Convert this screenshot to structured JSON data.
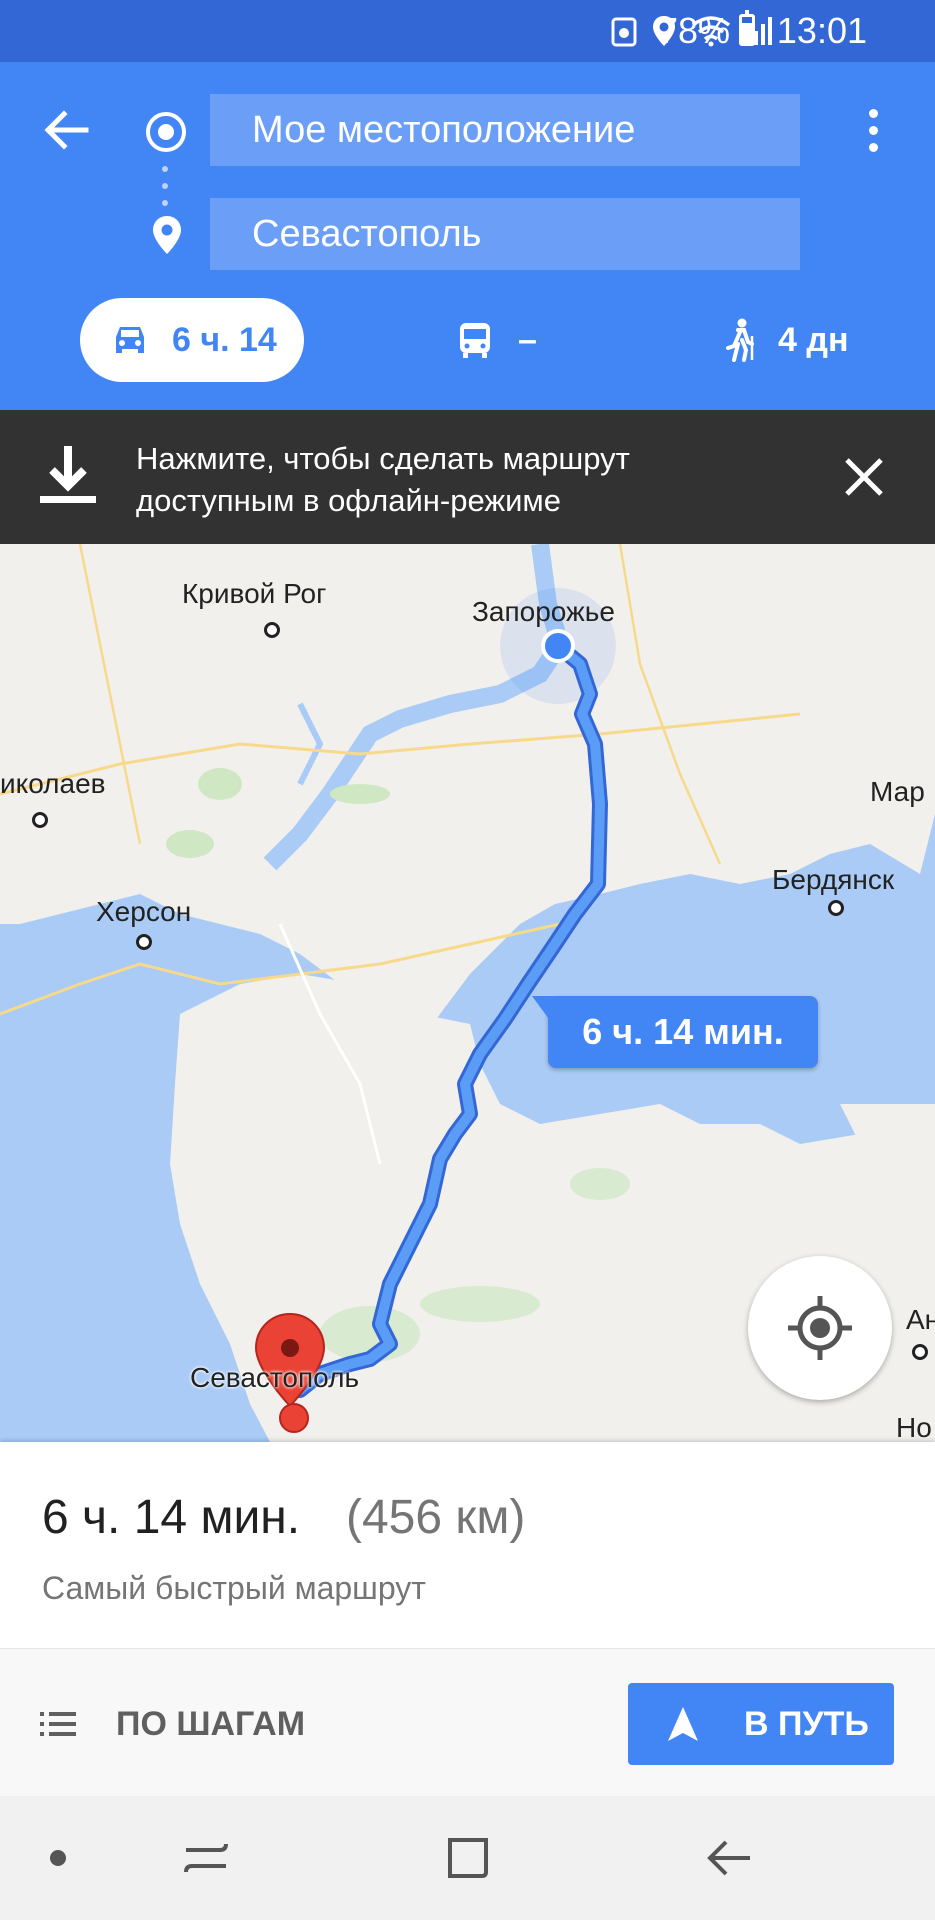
{
  "status_bar": {
    "battery": "78%",
    "time": "13:01",
    "icons": [
      "recycle-icon",
      "location-icon",
      "wifi-icon",
      "signal-icon",
      "battery-icon"
    ]
  },
  "header": {
    "origin": "Мое местоположение",
    "destination": "Севастополь"
  },
  "modes": {
    "car": "6 ч. 14",
    "transit": "–",
    "walk": "4 дн"
  },
  "offline_banner": {
    "line1": "Нажмите, чтобы сделать маршрут",
    "line2": "доступным в офлайн-режиме"
  },
  "map": {
    "labels": {
      "krivoy_rog": "Кривой Рог",
      "zaporozhye": "Запорожье",
      "nikolaev": "иколаев",
      "kherson": "Херсон",
      "berdyansk": "Бердянск",
      "mar": "Мар",
      "sevastopol": "Севастополь",
      "ana": "Ана",
      "no": "Но"
    },
    "eta_bubble": "6 ч. 14 мин."
  },
  "info": {
    "time": "6 ч. 14 мин.",
    "distance": "(456 км)",
    "note": "Самый быстрый маршрут"
  },
  "actions": {
    "steps": "ПО ШАГАМ",
    "go": "В ПУТЬ"
  },
  "colors": {
    "primary": "#4285f4",
    "status_bar": "#3367d6",
    "banner": "#323232",
    "water": "#a9cbf5",
    "land": "#f2f0ec",
    "marker": "#ea4335"
  }
}
